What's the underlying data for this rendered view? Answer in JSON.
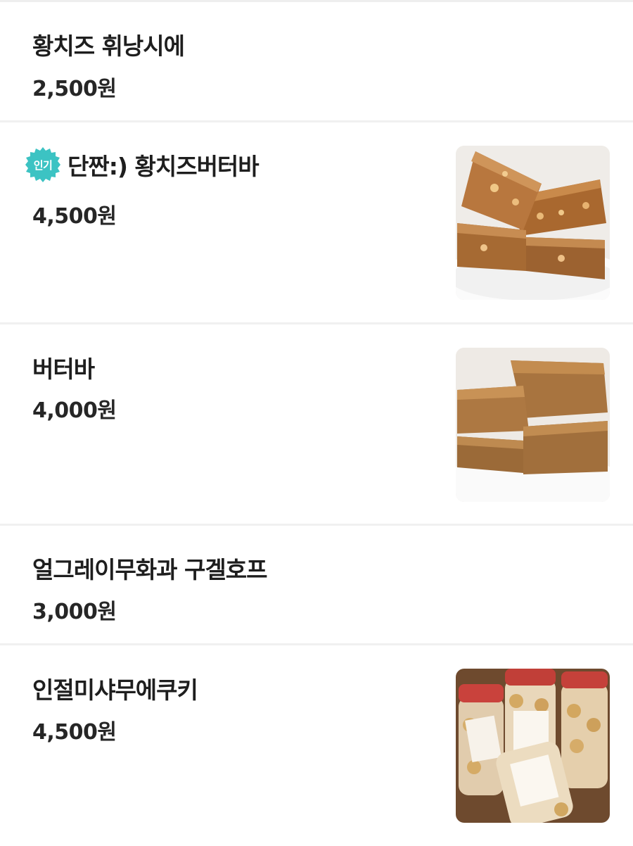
{
  "menu": {
    "items": [
      {
        "name": "황치즈 휘낭시에",
        "price": "2,500원",
        "popular": false,
        "has_image": false
      },
      {
        "name": "단짠:) 황치즈버터바",
        "price": "4,500원",
        "popular": true,
        "badge_label": "인기",
        "has_image": true,
        "image_icon": "cheese-butter-bar-photo"
      },
      {
        "name": "버터바",
        "price": "4,000원",
        "popular": false,
        "has_image": true,
        "image_icon": "butter-bar-photo"
      },
      {
        "name": "얼그레이무화과 구겔호프",
        "price": "3,000원",
        "popular": false,
        "has_image": false
      },
      {
        "name": "인절미샤무에쿠키",
        "price": "4,500원",
        "popular": false,
        "has_image": true,
        "image_icon": "cookie-jars-photo"
      }
    ]
  },
  "colors": {
    "badge": "#3cc3c3",
    "divider": "#f0f0f0",
    "text": "#1e1e1e"
  }
}
